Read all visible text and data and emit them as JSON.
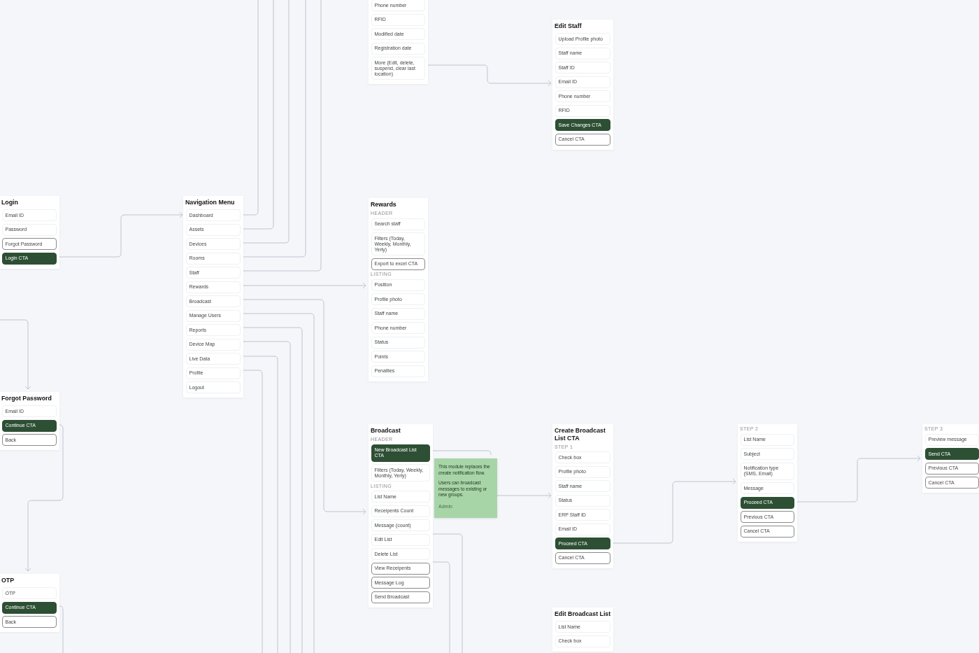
{
  "cards": [
    {
      "items": [
        {
          "kind": "field",
          "label": "Phone number"
        },
        {
          "kind": "field",
          "label": "RFID"
        },
        {
          "kind": "field",
          "label": "Modified date"
        },
        {
          "kind": "field",
          "label": "Registration date"
        },
        {
          "kind": "field",
          "label": "More (Edit, delete, suspend, clear last location)"
        }
      ]
    },
    {
      "title": "Edit Staff",
      "items": [
        {
          "kind": "field",
          "label": "Upload Profile photo"
        },
        {
          "kind": "field",
          "label": "Staff name"
        },
        {
          "kind": "field",
          "label": "Staff ID"
        },
        {
          "kind": "field",
          "label": "Email ID"
        },
        {
          "kind": "field",
          "label": "Phone number"
        },
        {
          "kind": "field",
          "label": "RFID"
        },
        {
          "kind": "primary",
          "label": "Save Changes CTA"
        },
        {
          "kind": "outline",
          "label": "Cancel CTA"
        }
      ]
    },
    {
      "title": "Login",
      "items": [
        {
          "kind": "field",
          "label": "Email ID"
        },
        {
          "kind": "field",
          "label": "Password"
        },
        {
          "kind": "outline",
          "label": "Forgot Password"
        },
        {
          "kind": "primary",
          "label": "Login CTA"
        }
      ]
    },
    {
      "title": "Navigation Menu",
      "items": [
        {
          "kind": "field",
          "label": "Dashboard"
        },
        {
          "kind": "field",
          "label": "Assets"
        },
        {
          "kind": "field",
          "label": "Devices"
        },
        {
          "kind": "field",
          "label": "Rooms"
        },
        {
          "kind": "field",
          "label": "Staff"
        },
        {
          "kind": "field",
          "label": "Rewards"
        },
        {
          "kind": "field",
          "label": "Broadcast"
        },
        {
          "kind": "field",
          "label": "Manage Users"
        },
        {
          "kind": "field",
          "label": "Reports"
        },
        {
          "kind": "field",
          "label": "Device Map"
        },
        {
          "kind": "field",
          "label": "Live Data"
        },
        {
          "kind": "field",
          "label": "Profile"
        },
        {
          "kind": "field",
          "label": "Logout"
        }
      ]
    },
    {
      "title": "Rewards",
      "items": [
        {
          "kind": "section",
          "label": "HEADER"
        },
        {
          "kind": "field",
          "label": "Search staff"
        },
        {
          "kind": "field",
          "label": "Filters (Today, Weekly, Monthly, Yerly)"
        },
        {
          "kind": "outline",
          "label": "Export to excel CTA"
        },
        {
          "kind": "section",
          "label": "LISTING"
        },
        {
          "kind": "field",
          "label": "Position"
        },
        {
          "kind": "field",
          "label": "Profile photo"
        },
        {
          "kind": "field",
          "label": "Staff name"
        },
        {
          "kind": "field",
          "label": "Phone number"
        },
        {
          "kind": "field",
          "label": "Status"
        },
        {
          "kind": "field",
          "label": "Points"
        },
        {
          "kind": "field",
          "label": "Penalties"
        }
      ]
    },
    {
      "title": "Forgot Password",
      "items": [
        {
          "kind": "field",
          "label": "Email ID"
        },
        {
          "kind": "primary",
          "label": "Continue CTA"
        },
        {
          "kind": "outline",
          "label": "Back"
        }
      ]
    },
    {
      "title": "Broadcast",
      "items": [
        {
          "kind": "section",
          "label": "HEADER"
        },
        {
          "kind": "primary",
          "label": "New Broadcast List CTA"
        },
        {
          "kind": "field",
          "label": "Filters (Today, Weekly, Monthly, Yerly)"
        },
        {
          "kind": "section",
          "label": "LISTING"
        },
        {
          "kind": "field",
          "label": "List Name"
        },
        {
          "kind": "field",
          "label": "Receipents Count"
        },
        {
          "kind": "field",
          "label": "Message (count)"
        },
        {
          "kind": "field",
          "label": "Edit List"
        },
        {
          "kind": "field",
          "label": "Delete List"
        },
        {
          "kind": "outline",
          "label": "View Receipents"
        },
        {
          "kind": "outline",
          "label": "Message Log"
        },
        {
          "kind": "outline",
          "label": "Send Broadcast"
        }
      ]
    },
    {
      "title": "Create Broadcast List CTA",
      "items": [
        {
          "kind": "section",
          "label": "STEP 1"
        },
        {
          "kind": "field",
          "label": "Check box"
        },
        {
          "kind": "field",
          "label": "Profile photo"
        },
        {
          "kind": "field",
          "label": "Staff name"
        },
        {
          "kind": "field",
          "label": "Status"
        },
        {
          "kind": "field",
          "label": "ERP Staff ID"
        },
        {
          "kind": "field",
          "label": "Email ID"
        },
        {
          "kind": "primary",
          "label": "Proceed CTA"
        },
        {
          "kind": "outline",
          "label": "Cancel CTA"
        }
      ]
    },
    {
      "items": [
        {
          "kind": "section",
          "label": "STEP 2"
        },
        {
          "kind": "field",
          "label": "List Name"
        },
        {
          "kind": "field",
          "label": "Subject"
        },
        {
          "kind": "field",
          "label": "Notification type (SMS, Email)"
        },
        {
          "kind": "field",
          "label": "Message"
        },
        {
          "kind": "primary",
          "label": "Proceed CTA"
        },
        {
          "kind": "outline",
          "label": "Previous CTA"
        },
        {
          "kind": "outline",
          "label": "Cancel CTA"
        }
      ]
    },
    {
      "items": [
        {
          "kind": "section",
          "label": "STEP 3"
        },
        {
          "kind": "field",
          "label": "Preview message"
        },
        {
          "kind": "primary",
          "label": "Send CTA"
        },
        {
          "kind": "outline",
          "label": "Previous CTA"
        },
        {
          "kind": "outline",
          "label": "Cancel CTA"
        }
      ]
    },
    {
      "title": "OTP",
      "items": [
        {
          "kind": "field",
          "label": "OTP"
        },
        {
          "kind": "primary",
          "label": "Continue CTA"
        },
        {
          "kind": "outline",
          "label": "Back"
        }
      ]
    },
    {
      "title": "Edit Broadcast List",
      "items": [
        {
          "kind": "field",
          "label": "List Name"
        },
        {
          "kind": "field",
          "label": "Check box"
        }
      ]
    }
  ],
  "note": {
    "paragraphs": [
      "This module replaces the create notification flow.",
      "Users can broadcast messages to existing or new groups."
    ],
    "author": "Admin"
  }
}
